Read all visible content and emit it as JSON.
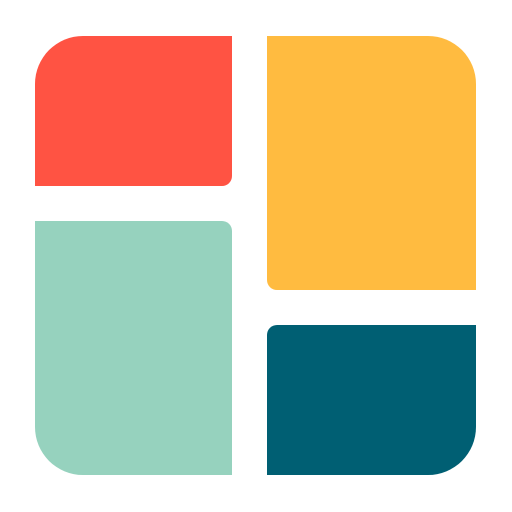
{
  "logo": {
    "icon": "four-tile-grid-icon",
    "tiles": [
      {
        "name": "tile-top-left",
        "color": "#FF5343"
      },
      {
        "name": "tile-top-right",
        "color": "#FFBB40"
      },
      {
        "name": "tile-bottom-left",
        "color": "#96D2BE"
      },
      {
        "name": "tile-bottom-right",
        "color": "#005F73"
      }
    ]
  }
}
